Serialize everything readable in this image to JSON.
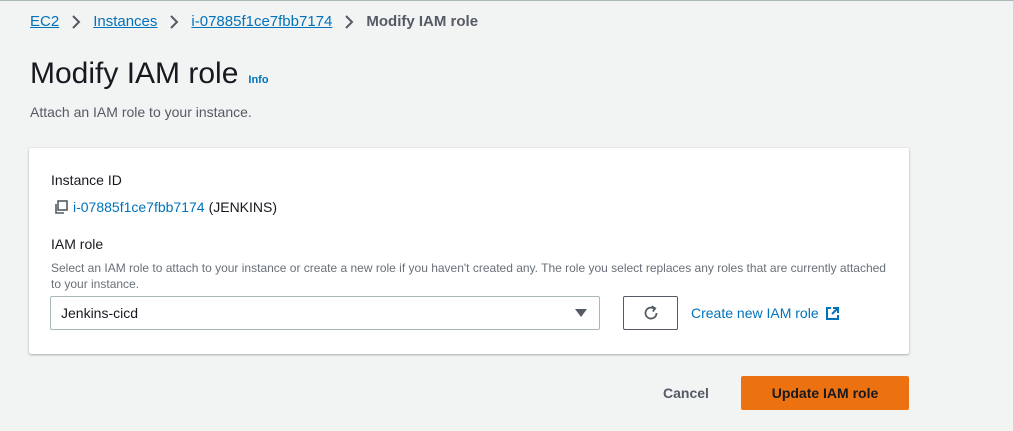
{
  "breadcrumb": {
    "items": [
      "EC2",
      "Instances",
      "i-07885f1ce7fbb7174"
    ],
    "current": "Modify IAM role"
  },
  "page": {
    "title": "Modify IAM role",
    "info_label": "Info",
    "description": "Attach an IAM role to your instance."
  },
  "instance": {
    "label": "Instance ID",
    "id": "i-07885f1ce7fbb7174",
    "name": "(JENKINS)"
  },
  "iam_role": {
    "label": "IAM role",
    "description": "Select an IAM role to attach to your instance or create a new role if you haven't created any. The role you select replaces any roles that are currently attached to your instance.",
    "selected": "Jenkins-cicd",
    "create_link": "Create new IAM role"
  },
  "actions": {
    "cancel": "Cancel",
    "submit": "Update IAM role"
  },
  "colors": {
    "link": "#0073bb",
    "primary_button": "#ec7211",
    "background": "#f2f3f3"
  },
  "icons": [
    "chevron-right-icon",
    "copy-icon",
    "refresh-icon",
    "caret-down-icon",
    "external-link-icon"
  ]
}
